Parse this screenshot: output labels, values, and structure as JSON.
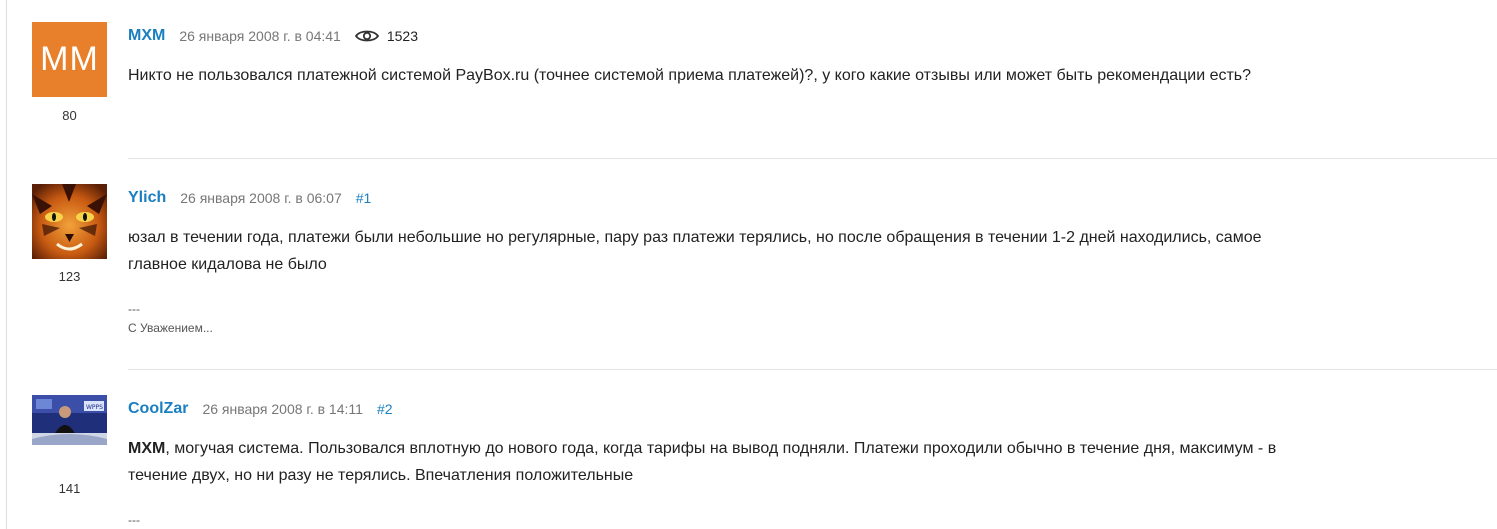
{
  "posts": [
    {
      "avatar_initials": "MM",
      "avatar_color": "#e8802b",
      "rating": "80",
      "author": "MXM",
      "date": "26 января 2008 г. в 04:41",
      "views": "1523",
      "text": "Никто не пользовался платежной системой PayBox.ru (точнее системой приема платежей)?, у кого какие отзывы или может быть рекомендации есть?"
    },
    {
      "avatar_description": "tiger-eyes-avatar",
      "rating": "123",
      "author": "Ylich",
      "date": "26 января 2008 г. в 06:07",
      "permalink": "#1",
      "text_line1": "юзал в течении года, платежи были небольшие но регулярные, пару раз платежи терялись, но после обращения в течении 1-2 дней находились, самое",
      "text_line2": "главное кидалова не было",
      "signature_line1": "---",
      "signature_line2": "С Уважением..."
    },
    {
      "avatar_description": "tv-studio-avatar",
      "rating": "141",
      "author": "CoolZar",
      "date": "26 января 2008 г. в 14:11",
      "permalink": "#2",
      "mention": "MXM",
      "text_rest_line1": ", могучая система. Пользовался вплотную до нового года, когда тарифы на вывод подняли. Платежи проходили обычно в течение дня, максимум - в",
      "text_line2": "течение двух, но ни разу не терялись. Впечатления положительные",
      "signature_line1": "---"
    }
  ],
  "colors": {
    "link": "#1a7fc1",
    "meta": "#777777",
    "divider": "#e5e5e5"
  },
  "icons": {
    "views": "eye-icon"
  }
}
